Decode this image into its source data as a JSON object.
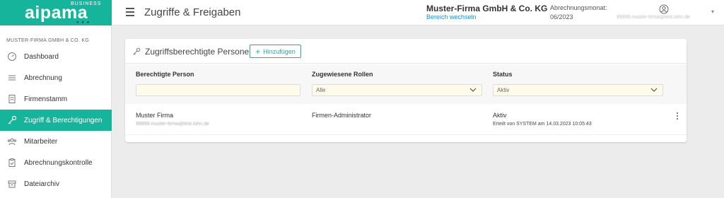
{
  "brand": {
    "logo": "aipama",
    "tag": "BUSINESS",
    "dots": "● ● ●"
  },
  "sidebar": {
    "company": "MUSTER-FIRMA GMBH & CO. KG",
    "items": [
      {
        "label": "Dashboard",
        "icon": "dashboard-gauge-icon"
      },
      {
        "label": "Abrechnung",
        "icon": "list-lines-icon"
      },
      {
        "label": "Firmenstamm",
        "icon": "building-icon"
      },
      {
        "label": "Zugriff & Berechtigungen",
        "icon": "key-icon",
        "active": true
      },
      {
        "label": "Mitarbeiter",
        "icon": "people-icon"
      },
      {
        "label": "Abrechnungskontrolle",
        "icon": "clipboard-check-icon"
      },
      {
        "label": "Dateiarchiv",
        "icon": "archive-box-icon"
      }
    ]
  },
  "header": {
    "title": "Zugriffe & Freigaben",
    "company_name": "Muster-Firma GmbH & Co. KG",
    "switch_label": "Bereich wechseln",
    "month_label": "Abrechnungsmonat:",
    "month_value": "06/2023",
    "user_email": "99999.muster-firma@test.lohn.de"
  },
  "card": {
    "title": "Zugriffsberechtigte Personen",
    "add_label": "Hinzufügen",
    "columns": [
      "Berechtigte Person",
      "Zugewiesene Rollen",
      "Status"
    ],
    "filters": {
      "person_value": "",
      "roles_value": "Alle",
      "status_value": "Aktiv"
    },
    "rows": [
      {
        "name": "Muster Firma",
        "email": "99999.muster-firma@test.lohn.de",
        "role": "Firmen-Administrator",
        "status": "Aktiv",
        "created": "Erteilt von SYSTEM am 14.03.2023 10:05:43"
      }
    ]
  },
  "colors": {
    "accent": "#16b49b",
    "link": "#1f8ed1",
    "filter_bg": "#fffbea"
  }
}
